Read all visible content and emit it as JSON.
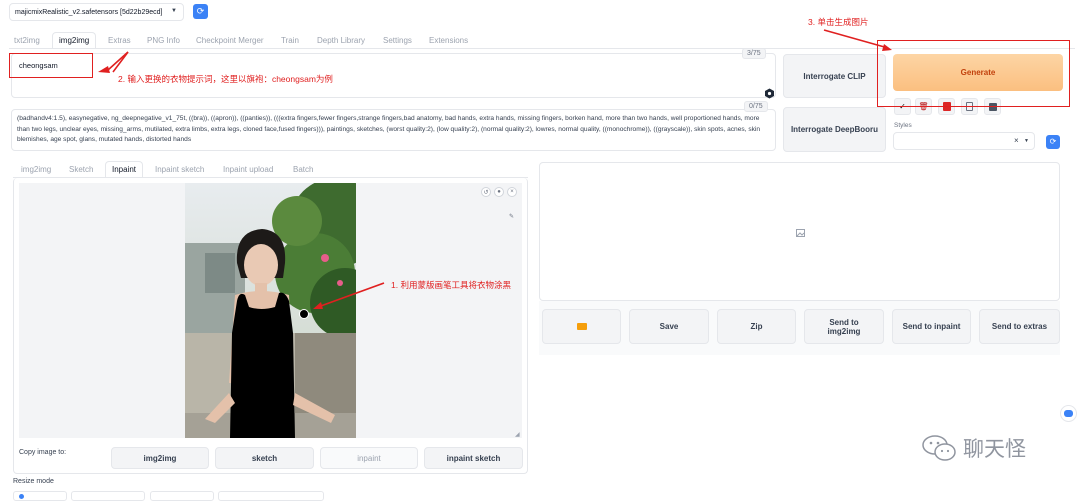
{
  "header": {
    "model_select": "majicmixRealistic_v2.safetensors [5d22b29ecd]"
  },
  "main_tabs": [
    {
      "label": "txt2img"
    },
    {
      "label": "img2img"
    },
    {
      "label": "Extras"
    },
    {
      "label": "PNG Info"
    },
    {
      "label": "Checkpoint Merger"
    },
    {
      "label": "Train"
    },
    {
      "label": "Depth Library"
    },
    {
      "label": "Settings"
    },
    {
      "label": "Extensions"
    }
  ],
  "prompt": {
    "value": "cheongsam",
    "counter": "3/75"
  },
  "negative_prompt": {
    "value": "(badhandv4:1.5), easynegative, ng_deepnegative_v1_75t, ((bra)), ((apron)), ((panties)), (((extra fingers,fewer fingers,strange fingers,bad anatomy, bad hands, extra hands, missing fingers, borken hand, more than two hands, well proportioned hands, more than two legs, unclear eyes, missing_arms, mutilated, extra limbs, extra legs, cloned face,fused fingers))), paintings, sketches, (worst quality:2), (low quality:2), (normal quality:2), lowres, normal quality, ((monochrome)), ((grayscale)), skin spots, acnes, skin blemishes, age spot, glans, mutated hands, distorted hands",
    "counter": "0/75"
  },
  "buttons": {
    "interrogate_clip": "Interrogate CLIP",
    "interrogate_deepbooru": "Interrogate DeepBooru",
    "generate": "Generate"
  },
  "styles": {
    "label": "Styles",
    "clear": "×"
  },
  "sub_tabs": [
    {
      "label": "img2img"
    },
    {
      "label": "Sketch"
    },
    {
      "label": "Inpaint"
    },
    {
      "label": "Inpaint sketch"
    },
    {
      "label": "Inpaint upload"
    },
    {
      "label": "Batch"
    }
  ],
  "copy_image": {
    "label": "Copy image to:",
    "buttons": [
      "img2img",
      "sketch",
      "inpaint",
      "inpaint sketch"
    ]
  },
  "output_buttons": {
    "save": "Save",
    "zip": "Zip",
    "send_img2img": "Send to img2img",
    "send_inpaint": "Send to inpaint",
    "send_extras": "Send to extras"
  },
  "resize_mode": {
    "label": "Resize mode"
  },
  "annotations": {
    "a1": "1. 利用蒙版画笔工具将衣物涂黑",
    "a2": "2. 输入更换的衣物提示词，这里以旗袍：cheongsam为例",
    "a3": "3. 单击生成图片"
  },
  "watermark": {
    "text": "聊天怪"
  },
  "colors": {
    "generate_bg": "#fbc58a",
    "generate_text": "#c2410c",
    "annotation": "#e02020",
    "refresh_btn": "#3b82f6"
  },
  "icons": {
    "refresh": "refresh-icon",
    "folder": "folder-icon",
    "paint": "palette-icon",
    "image_placeholder": "image-icon"
  }
}
